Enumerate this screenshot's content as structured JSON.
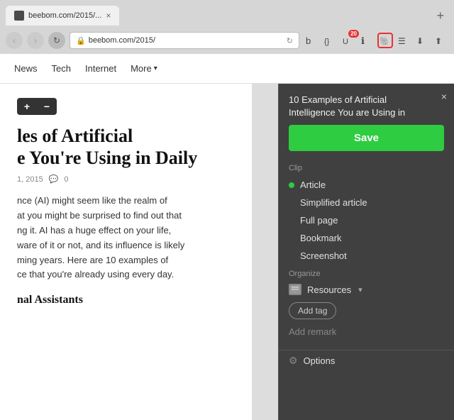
{
  "browser": {
    "tab": {
      "title": "beebom.com/2015/...",
      "favicon": "b"
    },
    "address": "beebom.com/2015/",
    "badge_count": "20",
    "nav_buttons": [
      "←",
      "→",
      "↻"
    ]
  },
  "site": {
    "nav_links": [
      {
        "label": "News",
        "active": false
      },
      {
        "label": "Tech",
        "active": false
      },
      {
        "label": "Internet",
        "active": false
      },
      {
        "label": "More",
        "active": false,
        "has_arrow": true
      }
    ]
  },
  "article": {
    "zoom_plus": "+",
    "zoom_minus": "−",
    "heading": "les of Artificial\ne You're Using in Daily",
    "date": "1, 2015",
    "comments": "0",
    "body": "nce (AI) might seem like the realm of\nat you might be surprised to find out that\nng it. AI has a huge effect on your life,\nware of it or not, and its influence is likely\nming years. Here are 10 examples of\nce that you're already using every day.",
    "subheading": "nal Assistants"
  },
  "evernote_popup": {
    "close_label": "×",
    "title": "10 Examples of Artificial Intelligence You are Using in",
    "save_label": "Save",
    "clip_section_label": "Clip",
    "clip_options": [
      {
        "label": "Article",
        "selected": true
      },
      {
        "label": "Simplified article",
        "selected": false
      },
      {
        "label": "Full page",
        "selected": false
      },
      {
        "label": "Bookmark",
        "selected": false
      },
      {
        "label": "Screenshot",
        "selected": false
      }
    ],
    "organize_section_label": "Organize",
    "notebook_name": "Resources",
    "add_tag_label": "Add tag",
    "add_remark_label": "Add remark",
    "options_label": "Options"
  },
  "icons": {
    "back": "‹",
    "forward": "›",
    "reload": "↻",
    "lock": "🔒",
    "download": "⬇",
    "share": "⬆",
    "menu": "☰",
    "evernote": "🐘",
    "gear": "⚙"
  }
}
